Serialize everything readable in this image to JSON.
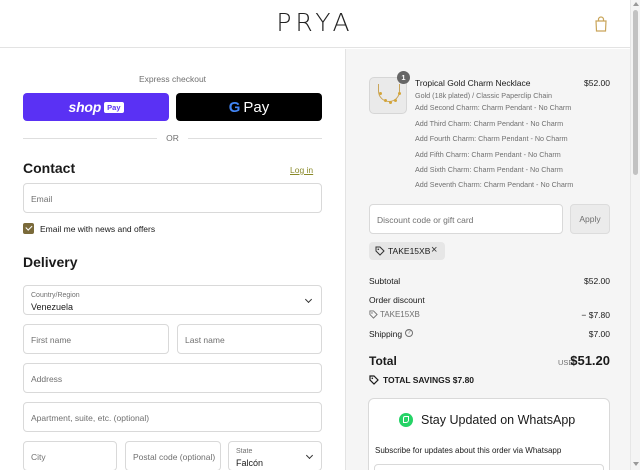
{
  "header": {
    "logo": "PRYA",
    "cart_icon": "shopping-bag-icon"
  },
  "express": {
    "label": "Express checkout",
    "shop_pay": {
      "shop": "shop",
      "pay": "Pay",
      "color": "#5a31f4"
    },
    "gpay": {
      "g": "G",
      "pay": "Pay",
      "color": "#000000"
    },
    "or": "OR"
  },
  "contact": {
    "title": "Contact",
    "login": "Log in",
    "email_placeholder": "Email",
    "newsletter_label": "Email me with news and offers",
    "newsletter_checked": true
  },
  "delivery": {
    "title": "Delivery",
    "country_label": "Country/Region",
    "country_value": "Venezuela",
    "first_name_placeholder": "First name",
    "last_name_placeholder": "Last name",
    "address_placeholder": "Address",
    "apartment_placeholder": "Apartment, suite, etc. (optional)",
    "city_placeholder": "City",
    "postal_placeholder": "Postal code (optional)",
    "state_label": "State",
    "state_value": "Falcón"
  },
  "order": {
    "quantity": "1",
    "product_name": "Tropical Gold Charm Necklace",
    "product_price": "$52.00",
    "variant": "Gold (18k plated) / Classic Paperclip Chain",
    "options": [
      "Add Second Charm: Charm Pendant - No Charm",
      "Add Third Charm: Charm Pendant - No Charm",
      "Add Fourth Charm: Charm Pendant - No Charm",
      "Add Fifth Charm: Charm Pendant - No Charm",
      "Add Sixth Charm: Charm Pendant - No Charm",
      "Add Seventh Charm: Charm Pendant - No Charm"
    ]
  },
  "discount": {
    "placeholder": "Discount code or gift card",
    "apply": "Apply",
    "applied_code": "TAKE15XB"
  },
  "summary": {
    "subtotal_label": "Subtotal",
    "subtotal": "$52.00",
    "order_discount_label": "Order discount",
    "discount_code": "TAKE15XB",
    "discount_amount": "− $7.80",
    "shipping_label": "Shipping",
    "shipping": "$7.00",
    "total_label": "Total",
    "currency": "USD",
    "total": "$51.20",
    "savings_label": "TOTAL SAVINGS",
    "savings": "$7.80"
  },
  "whatsapp": {
    "title": "Stay Updated on WhatsApp",
    "description": "Subscribe for updates about this order via Whatsapp",
    "color": "#25d366"
  }
}
